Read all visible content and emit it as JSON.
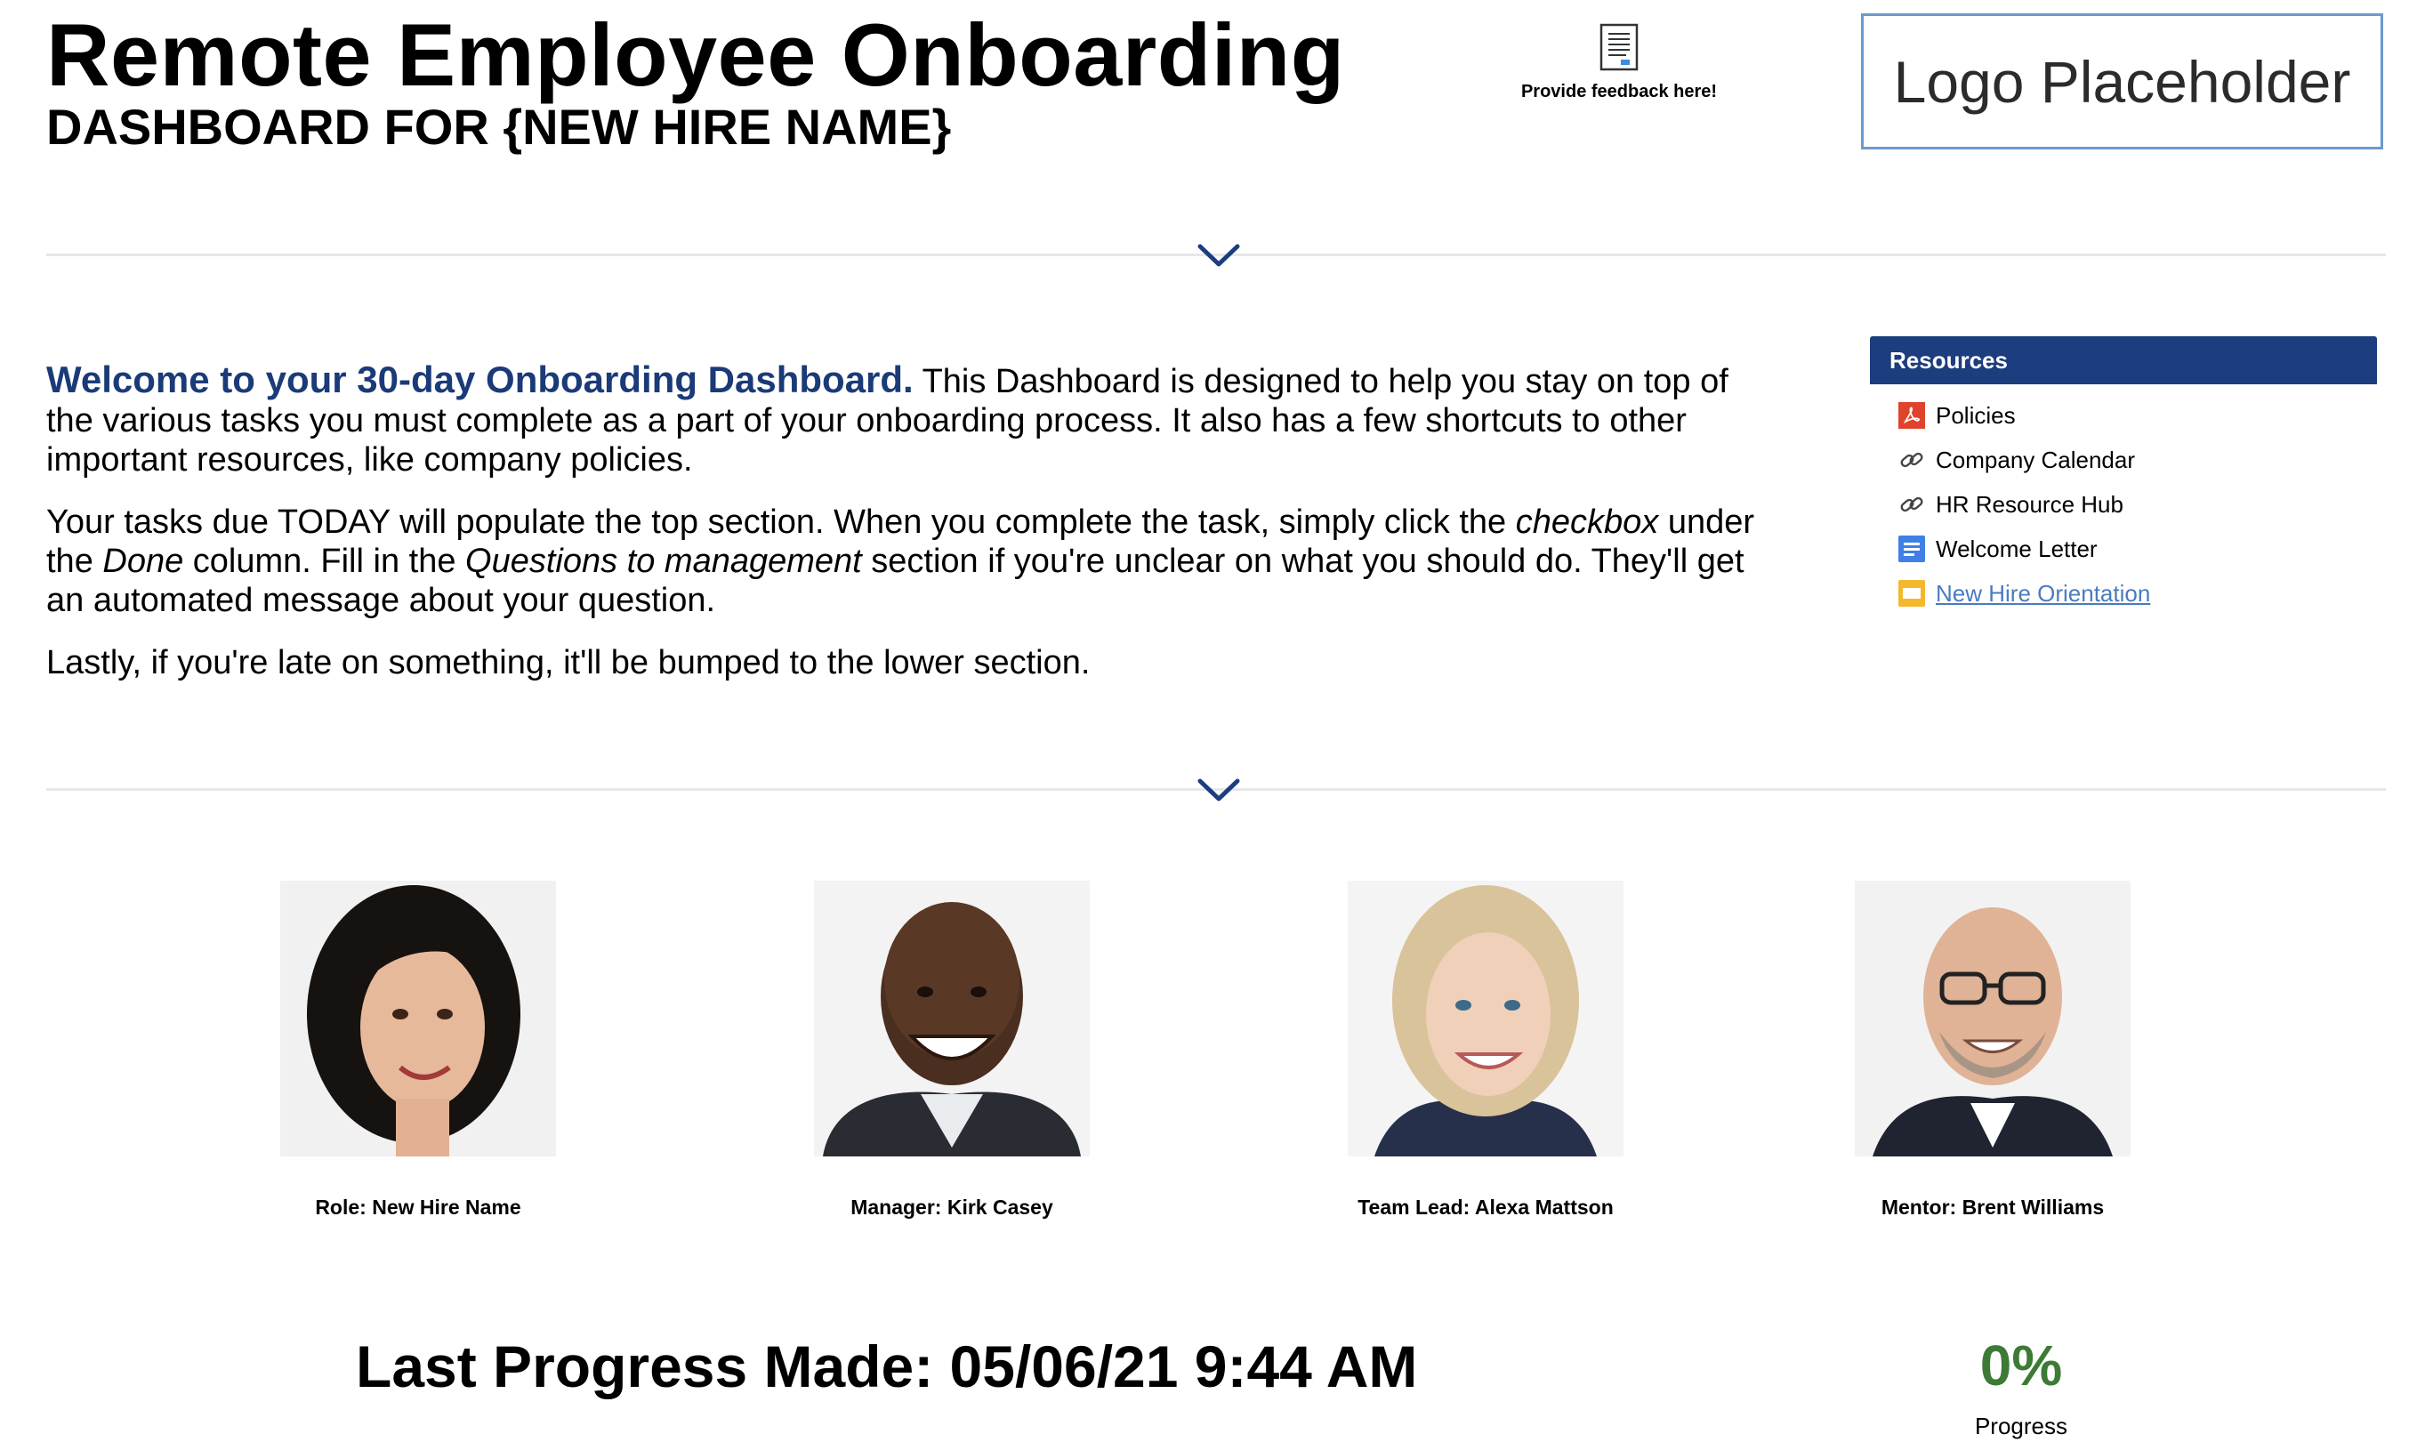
{
  "header": {
    "title": "Remote Employee Onboarding",
    "subtitle": "DASHBOARD FOR {NEW HIRE NAME}",
    "feedback_label": "Provide feedback here!",
    "logo_text": "Logo Placeholder"
  },
  "intro": {
    "lead": "Welcome to your 30-day Onboarding Dashboard.",
    "p1_rest": " This Dashboard is designed to help you stay on top of the various tasks you must complete as a part of your onboarding process. It also has a few shortcuts to other important resources, like company policies.",
    "p2_a": "Your tasks due TODAY will populate the top section. When you complete the task, simply click the ",
    "p2_em1": "checkbox",
    "p2_b": " under the ",
    "p2_em2": "Done",
    "p2_c": " column. Fill in the ",
    "p2_em3": "Questions to management",
    "p2_d": " section if you're unclear on what you should do. They'll get an automated message about your question.",
    "p3": "Lastly, if you're late on something, it'll be bumped to the lower section."
  },
  "resources": {
    "header": "Resources",
    "items": [
      {
        "label": "Policies",
        "icon": "pdf-icon"
      },
      {
        "label": "Company Calendar",
        "icon": "link-icon"
      },
      {
        "label": "HR Resource Hub",
        "icon": "link-icon"
      },
      {
        "label": "Welcome Letter",
        "icon": "doc-icon"
      },
      {
        "label": "New Hire Orientation",
        "icon": "slides-icon"
      }
    ]
  },
  "people": [
    {
      "caption": "Role: New Hire Name"
    },
    {
      "caption": "Manager: Kirk Casey"
    },
    {
      "caption": "Team Lead: Alexa Mattson"
    },
    {
      "caption": "Mentor: Brent Williams"
    }
  ],
  "progress": {
    "last_progress": "Last Progress Made: 05/06/21 9:44 AM",
    "percent": "0%",
    "label": "Progress"
  },
  "colors": {
    "accent_blue": "#1c3d7e",
    "progress_green": "#3c7a35",
    "logo_border": "#6b9acb"
  }
}
